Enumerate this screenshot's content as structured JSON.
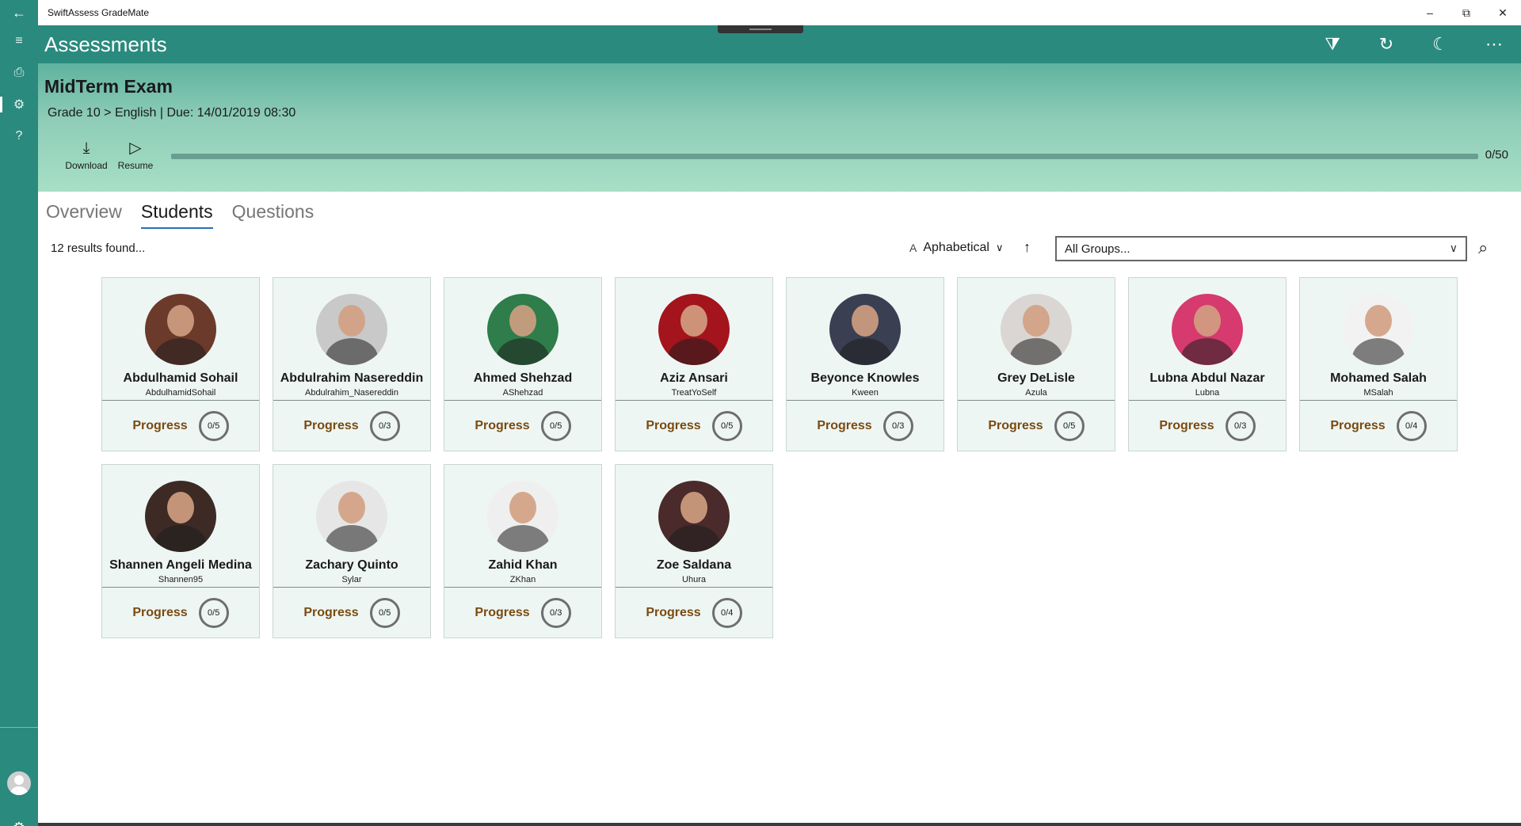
{
  "window": {
    "title": "SwiftAssess GradeMate",
    "back_glyph": "←",
    "controls": [
      "–",
      "⧉",
      "✕"
    ]
  },
  "rail": {
    "menu_glyph": "≡",
    "items": [
      {
        "icon": "document-icon",
        "glyph": "⎙"
      },
      {
        "icon": "assessments-icon",
        "glyph": "⚙"
      },
      {
        "icon": "help-icon",
        "glyph": "?"
      }
    ],
    "settings_glyph": "⚙"
  },
  "header": {
    "title": "Assessments",
    "actions": [
      {
        "icon": "filter-icon",
        "glyph": "⧩"
      },
      {
        "icon": "refresh-icon",
        "glyph": "↻"
      },
      {
        "icon": "theme-moon-icon",
        "glyph": "☾"
      },
      {
        "icon": "more-icon",
        "glyph": "⋯"
      }
    ]
  },
  "assessment": {
    "title": "MidTerm Exam",
    "meta": "Grade 10 > English | Due: 14/01/2019 08:30",
    "download_label": "Download",
    "resume_label": "Resume",
    "progress_text": "0/50",
    "progress_fraction": 0
  },
  "tabs": [
    "Overview",
    "Students",
    "Questions"
  ],
  "active_tab": "Students",
  "toolbar": {
    "results": "12 results found...",
    "sort_prefix": "A",
    "sort_label": "Aphabetical",
    "sort_dir_glyph": "↑",
    "groups_value": "All Groups...",
    "search_glyph": "⌕"
  },
  "students": [
    {
      "name": "Abdulhamid Sohail",
      "username": "AbdulhamidSohail",
      "progress_label": "Progress",
      "progress": "0/5",
      "avatar_color": "#6b3a2a"
    },
    {
      "name": "Abdulrahim Nasereddin",
      "username": "Abdulrahim_Nasereddin",
      "progress_label": "Progress",
      "progress": "0/3",
      "avatar_color": "#c9c9c9"
    },
    {
      "name": "Ahmed Shehzad",
      "username": "AShehzad",
      "progress_label": "Progress",
      "progress": "0/5",
      "avatar_color": "#2f7d4a"
    },
    {
      "name": "Aziz Ansari",
      "username": "TreatYoSelf",
      "progress_label": "Progress",
      "progress": "0/5",
      "avatar_color": "#a3141c"
    },
    {
      "name": "Beyonce Knowles",
      "username": "Kween",
      "progress_label": "Progress",
      "progress": "0/3",
      "avatar_color": "#3a3f52"
    },
    {
      "name": "Grey DeLisle",
      "username": "Azula",
      "progress_label": "Progress",
      "progress": "0/5",
      "avatar_color": "#d9d6d3"
    },
    {
      "name": "Lubna Abdul Nazar",
      "username": "Lubna",
      "progress_label": "Progress",
      "progress": "0/3",
      "avatar_color": "#d63a6e"
    },
    {
      "name": "Mohamed Salah",
      "username": "MSalah",
      "progress_label": "Progress",
      "progress": "0/4",
      "avatar_color": "#f2f2f2"
    },
    {
      "name": "Shannen Angeli Medina",
      "username": "Shannen95",
      "progress_label": "Progress",
      "progress": "0/5",
      "avatar_color": "#3d2a24"
    },
    {
      "name": "Zachary Quinto",
      "username": "Sylar",
      "progress_label": "Progress",
      "progress": "0/5",
      "avatar_color": "#e6e6e6"
    },
    {
      "name": "Zahid Khan",
      "username": "ZKhan",
      "progress_label": "Progress",
      "progress": "0/3",
      "avatar_color": "#efefef"
    },
    {
      "name": "Zoe Saldana",
      "username": "Uhura",
      "progress_label": "Progress",
      "progress": "0/4",
      "avatar_color": "#4a2a2a"
    }
  ],
  "colors": {
    "accent": "#2a8a7e",
    "progress_label": "#7a4a10",
    "tab_underline": "#2a6fb0"
  }
}
